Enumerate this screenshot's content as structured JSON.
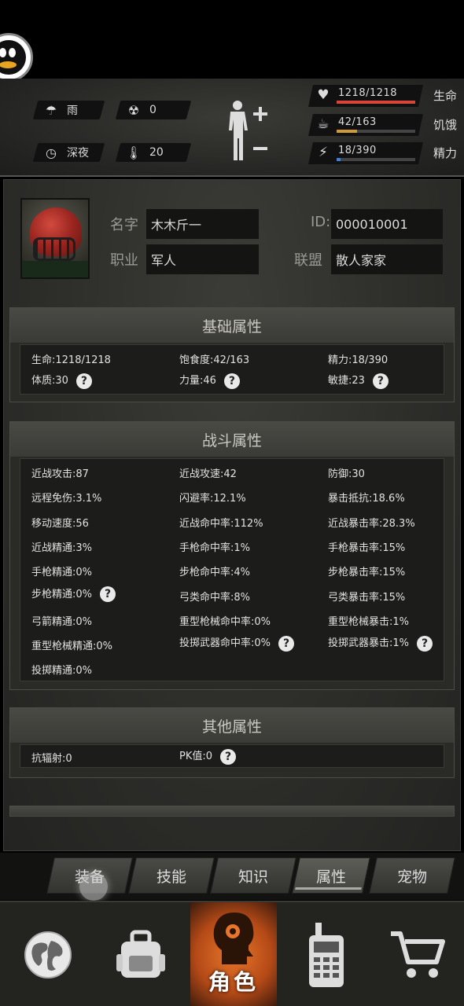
{
  "status": {
    "weather": "雨",
    "radiation": "0",
    "time_of_day": "深夜",
    "temperature": "20",
    "weather_icon": "rain-cloud-icon",
    "radiation_icon": "radiation-icon",
    "time_icon": "clock-icon",
    "temperature_icon": "thermometer-icon"
  },
  "vitals": [
    {
      "label": "生命",
      "value": "1218/1218",
      "fraction": 1.0,
      "color": "#d8463a",
      "icon": "heart-pulse-icon"
    },
    {
      "label": "饥饿",
      "value": "42/163",
      "fraction": 0.26,
      "color": "#d09a35",
      "icon": "stomach-icon"
    },
    {
      "label": "精力",
      "value": "18/390",
      "fraction": 0.05,
      "color": "#3f7fd4",
      "icon": "head-energy-icon"
    }
  ],
  "profile": {
    "name_label": "名字",
    "name": "木木斤一",
    "id_label": "ID",
    "id": "000010001",
    "job_label": "职业",
    "job": "军人",
    "alliance_label": "联盟",
    "alliance": "散人家家"
  },
  "basic": {
    "title": "基础属性",
    "hp": "生命:1218/1218",
    "satiety": "饱食度:42/163",
    "energy": "精力:18/390",
    "constitution": "体质:30",
    "strength": "力量:46",
    "agility": "敏捷:23"
  },
  "combat": {
    "title": "战斗属性",
    "items": [
      "近战攻击:87",
      "近战攻速:42",
      "防御:30",
      "远程免伤:3.1%",
      "闪避率:12.1%",
      "暴击抵抗:18.6%",
      "移动速度:56",
      "近战命中率:112%",
      "近战暴击率:28.3%",
      "近战精通:3%",
      "手枪命中率:1%",
      "手枪暴击率:15%",
      "手枪精通:0%",
      "步枪命中率:4%",
      "步枪暴击率:15%",
      "步枪精通:0%",
      "弓类命中率:8%",
      "弓类暴击率:15%",
      "弓箭精通:0%",
      "重型枪械命中率:0%",
      "重型枪械暴击:1%",
      "重型枪械精通:0%",
      "投掷武器命中率:0%",
      "投掷武器暴击:1%",
      "投掷精通:0%"
    ]
  },
  "other": {
    "title": "其他属性",
    "radiation_resist": "抗辐射:0",
    "pk": "PK值:0"
  },
  "tabs": [
    "装备",
    "技能",
    "知识",
    "属性",
    "宠物"
  ],
  "nav": {
    "character_label": "角色"
  }
}
